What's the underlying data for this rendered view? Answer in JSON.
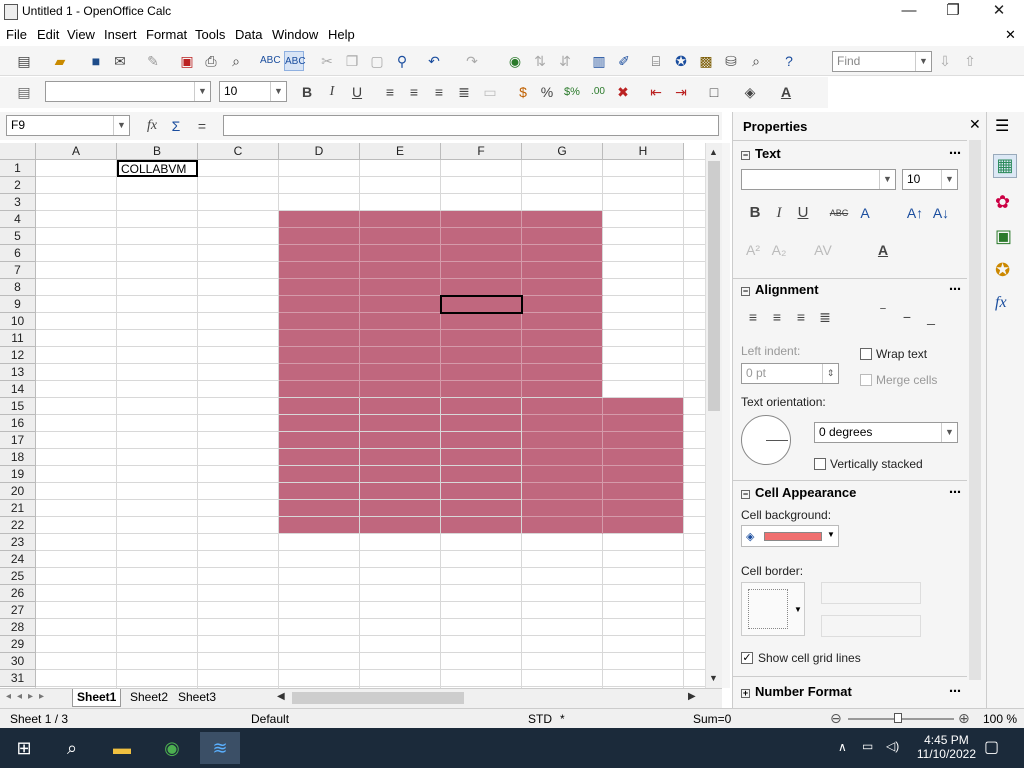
{
  "window": {
    "title": "Untitled 1 - OpenOffice Calc",
    "minimize": "—",
    "maximize": "❐",
    "close": "✕"
  },
  "menu": [
    "File",
    "Edit",
    "View",
    "Insert",
    "Format",
    "Tools",
    "Data",
    "Window",
    "Help"
  ],
  "menu_close": "✕",
  "toolbar": {
    "find_placeholder": "Find",
    "font_size": "10"
  },
  "formula": {
    "name_box": "F9",
    "fx": "fx",
    "sum": "Σ",
    "equals": "="
  },
  "columns": [
    "A",
    "B",
    "C",
    "D",
    "E",
    "F",
    "G",
    "H"
  ],
  "rows": [
    "1",
    "2",
    "3",
    "4",
    "5",
    "6",
    "7",
    "8",
    "9",
    "10",
    "11",
    "12",
    "13",
    "14",
    "15",
    "16",
    "17",
    "18",
    "19",
    "20",
    "21",
    "22",
    "23",
    "24",
    "25",
    "26",
    "27",
    "28",
    "29",
    "30",
    "31"
  ],
  "cells": {
    "B1": "COLLABVM"
  },
  "fill_color": "#c0677e",
  "sheets": [
    "Sheet1",
    "Sheet2",
    "Sheet3"
  ],
  "status": {
    "sheet": "Sheet 1 / 3",
    "style": "Default",
    "mode": "STD",
    "modified": "*",
    "sum": "Sum=0",
    "zoom": "100 %"
  },
  "sidebar": {
    "title": "Properties",
    "text_section": "Text",
    "font_size": "10",
    "alignment_section": "Alignment",
    "left_indent_label": "Left indent:",
    "left_indent_value": "0 pt",
    "wrap_text": "Wrap text",
    "merge_cells": "Merge cells",
    "text_orientation_label": "Text orientation:",
    "orientation_value": "0 degrees",
    "vertically_stacked": "Vertically stacked",
    "cell_appearance_section": "Cell Appearance",
    "cell_background_label": "Cell background:",
    "cell_background_color": "#f07070",
    "cell_border_label": "Cell border:",
    "show_grid_lines": "Show cell grid lines",
    "number_format_section": "Number Format"
  },
  "taskbar": {
    "time": "4:45 PM",
    "date": "11/10/2022"
  }
}
